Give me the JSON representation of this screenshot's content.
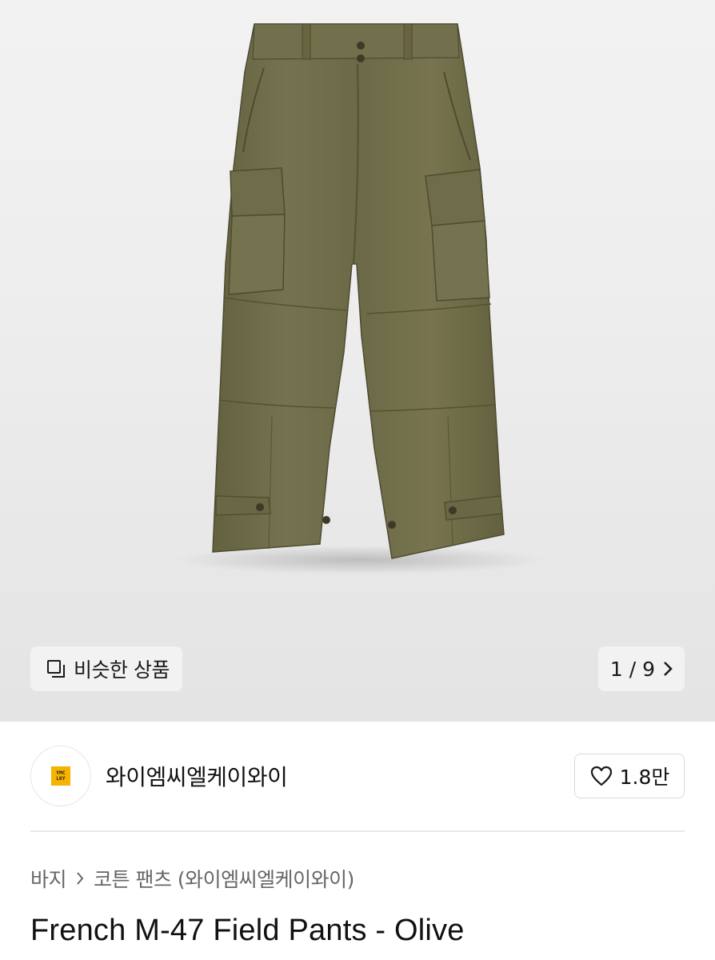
{
  "gallery": {
    "similar_label": "비슷한 상품",
    "pager_text": "1 / 9",
    "colors": {
      "pants": "#6e6b4a",
      "pants_dark": "#5a573b",
      "pants_light": "#7c7a57"
    }
  },
  "shop": {
    "logo_line1": "YMC",
    "logo_line2": "LKY",
    "name": "와이엠씨엘케이와이",
    "like_count": "1.8만",
    "logo_color": "#f5b400"
  },
  "category": {
    "level1": "바지",
    "level2": "코튼 팬츠",
    "brand": "(와이엠씨엘케이와이)"
  },
  "product": {
    "title": "French M-47 Field Pants - Olive"
  }
}
